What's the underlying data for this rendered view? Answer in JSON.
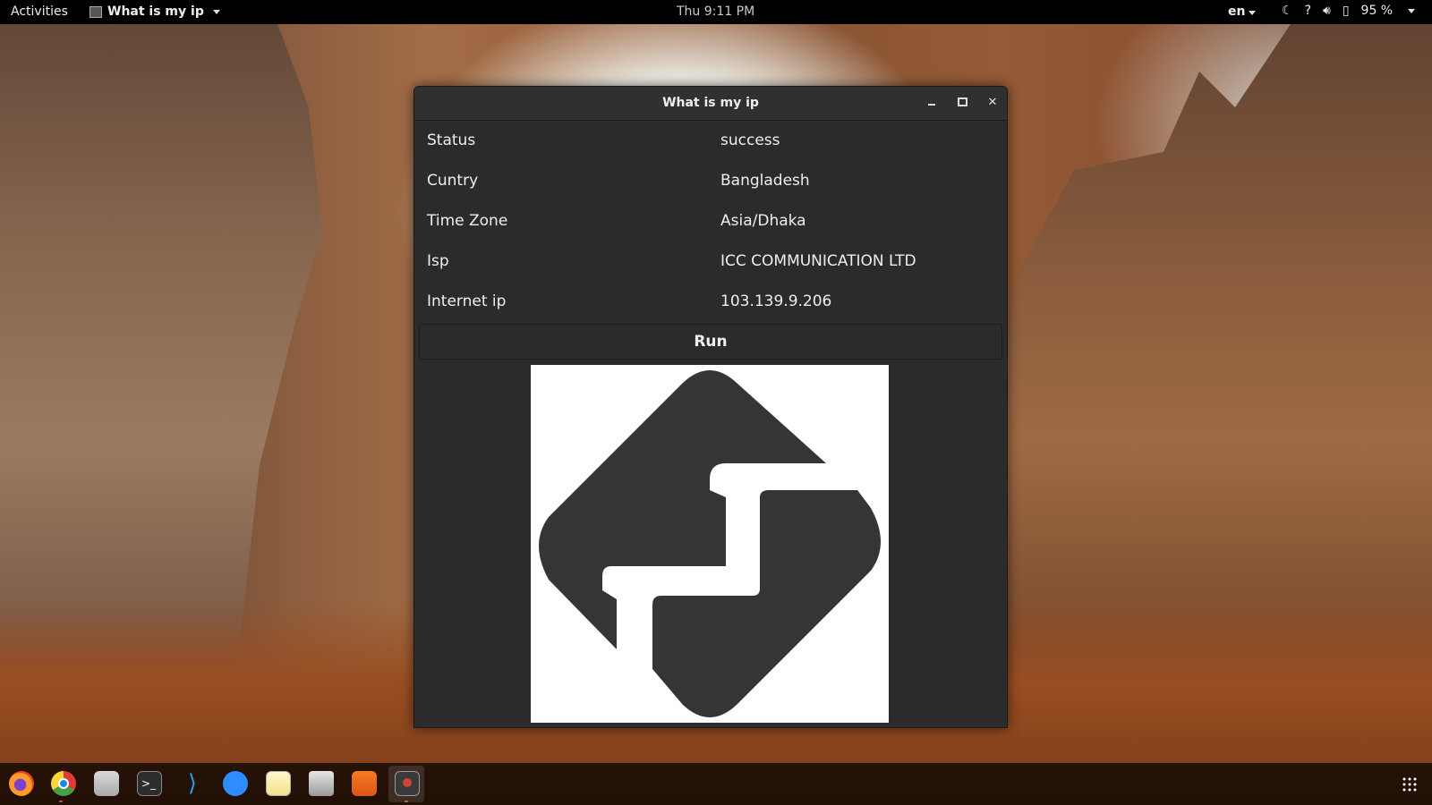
{
  "topbar": {
    "activities": "Activities",
    "app_name": "What is my ip",
    "clock": "Thu  9:11 PM",
    "lang": "en",
    "battery": "95 %"
  },
  "window": {
    "title": "What is my ip",
    "rows": [
      {
        "key": "Status",
        "value": "success"
      },
      {
        "key": "Cuntry",
        "value": "Bangladesh"
      },
      {
        "key": "Time Zone",
        "value": "Asia/Dhaka"
      },
      {
        "key": "Isp",
        "value": "ICC COMMUNICATION LTD"
      },
      {
        "key": "Internet ip",
        "value": "103.139.9.206"
      }
    ],
    "run_label": "Run"
  },
  "dock": {
    "apps": [
      "firefox-icon",
      "chrome-icon",
      "files-icon",
      "terminal-icon",
      "vscode-icon",
      "zoom-icon",
      "text-editor-icon",
      "screenshot-icon",
      "software-center-icon",
      "whatismyip-app-icon"
    ],
    "show_apps": "show-apps-icon"
  }
}
